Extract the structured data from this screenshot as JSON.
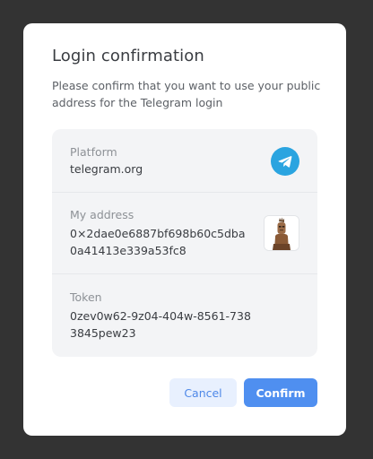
{
  "modal": {
    "title": "Login confirmation",
    "subtitle": "Please confirm that you want to use your public address for the Telegram login"
  },
  "details": {
    "platform": {
      "label": "Platform",
      "value": "telegram.org",
      "icon": "telegram-icon"
    },
    "address": {
      "label": "My address",
      "value": "0×2dae0e6887bf698b60c5dba0a41413e339a53fc8",
      "icon": "avatar-image"
    },
    "token": {
      "label": "Token",
      "value": "0zev0w62-9z04-404w-8561-7383845pew23"
    }
  },
  "buttons": {
    "cancel_label": "Cancel",
    "confirm_label": "Confirm"
  },
  "colors": {
    "accent": "#4f8ff0",
    "telegram": "#2aa4e0",
    "overlay": "#333333"
  }
}
